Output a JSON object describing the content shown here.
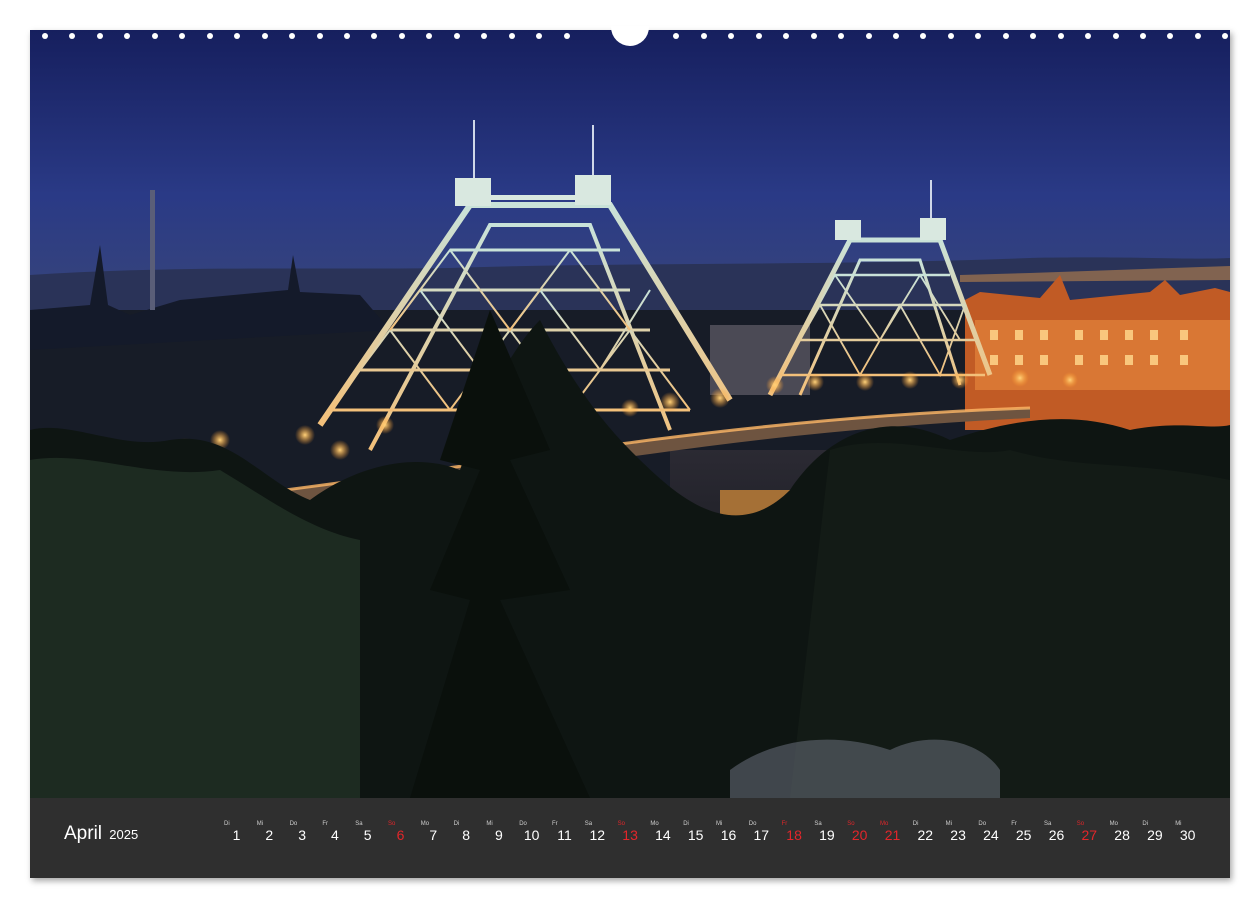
{
  "calendar": {
    "month": "April",
    "year": "2025",
    "days": [
      {
        "wd": "Di",
        "num": "1",
        "red": false
      },
      {
        "wd": "Mi",
        "num": "2",
        "red": false
      },
      {
        "wd": "Do",
        "num": "3",
        "red": false
      },
      {
        "wd": "Fr",
        "num": "4",
        "red": false
      },
      {
        "wd": "Sa",
        "num": "5",
        "red": false
      },
      {
        "wd": "So",
        "num": "6",
        "red": true
      },
      {
        "wd": "Mo",
        "num": "7",
        "red": false
      },
      {
        "wd": "Di",
        "num": "8",
        "red": false
      },
      {
        "wd": "Mi",
        "num": "9",
        "red": false
      },
      {
        "wd": "Do",
        "num": "10",
        "red": false
      },
      {
        "wd": "Fr",
        "num": "11",
        "red": false
      },
      {
        "wd": "Sa",
        "num": "12",
        "red": false
      },
      {
        "wd": "So",
        "num": "13",
        "red": true
      },
      {
        "wd": "Mo",
        "num": "14",
        "red": false
      },
      {
        "wd": "Di",
        "num": "15",
        "red": false
      },
      {
        "wd": "Mi",
        "num": "16",
        "red": false
      },
      {
        "wd": "Do",
        "num": "17",
        "red": false
      },
      {
        "wd": "Fr",
        "num": "18",
        "red": true
      },
      {
        "wd": "Sa",
        "num": "19",
        "red": false
      },
      {
        "wd": "So",
        "num": "20",
        "red": true
      },
      {
        "wd": "Mo",
        "num": "21",
        "red": true
      },
      {
        "wd": "Di",
        "num": "22",
        "red": false
      },
      {
        "wd": "Mi",
        "num": "23",
        "red": false
      },
      {
        "wd": "Do",
        "num": "24",
        "red": false
      },
      {
        "wd": "Fr",
        "num": "25",
        "red": false
      },
      {
        "wd": "Sa",
        "num": "26",
        "red": false
      },
      {
        "wd": "So",
        "num": "27",
        "red": true
      },
      {
        "wd": "Mo",
        "num": "28",
        "red": false
      },
      {
        "wd": "Di",
        "num": "29",
        "red": false
      },
      {
        "wd": "Mi",
        "num": "30",
        "red": false
      }
    ]
  },
  "colors": {
    "footer_bg": "#2f2f2f",
    "holiday_red": "#e2262a",
    "sky_top": "#1c2a6e",
    "sky_bottom": "#31407e",
    "bridge_lights": "#ffb23c"
  }
}
